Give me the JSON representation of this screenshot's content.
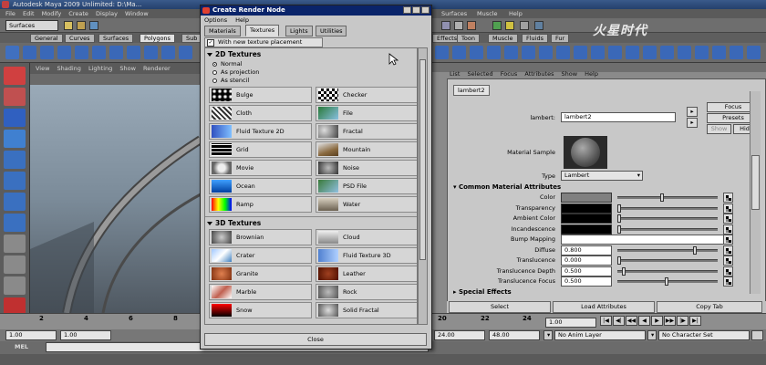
{
  "maya": {
    "title": "Autodesk Maya 2009 Unlimited: D:\\Ma...",
    "menus": [
      "File",
      "Edit",
      "Modify",
      "Create",
      "Display",
      "Window"
    ],
    "menus_right": [
      "Surfaces",
      "Muscle",
      "Help"
    ],
    "mode": "Surfaces",
    "shelf_tabs": [
      "General",
      "Curves",
      "Surfaces",
      "Polygons",
      "Sub"
    ],
    "shelf_tabs_right": [
      "Effects",
      "Toon",
      "Muscle",
      "Fluids",
      "Fur"
    ],
    "viewport_menu": [
      "View",
      "Shading",
      "Lighting",
      "Show",
      "Renderer"
    ],
    "watermark": "火星时代"
  },
  "dialog": {
    "title": "Create Render Node",
    "menus": [
      "Options",
      "Help"
    ],
    "tabs": [
      "Materials",
      "Textures",
      "Lights",
      "Utilities"
    ],
    "active_tab": "Textures",
    "checkbox_label": "With new texture placement",
    "section_2d": "2D Textures",
    "radios": [
      "Normal",
      "As projection",
      "As stencil"
    ],
    "textures_2d": [
      {
        "label": "Bulge",
        "icon": "bulge-icon"
      },
      {
        "label": "Checker",
        "icon": "checker-icon"
      },
      {
        "label": "Cloth",
        "icon": "cloth-icon"
      },
      {
        "label": "File",
        "icon": "file-icon"
      },
      {
        "label": "Fluid Texture 2D",
        "icon": "fluid-texture-2d-icon"
      },
      {
        "label": "Fractal",
        "icon": "fractal-icon"
      },
      {
        "label": "Grid",
        "icon": "grid-icon"
      },
      {
        "label": "Mountain",
        "icon": "mountain-icon"
      },
      {
        "label": "Movie",
        "icon": "movie-icon"
      },
      {
        "label": "Noise",
        "icon": "noise-icon"
      },
      {
        "label": "Ocean",
        "icon": "ocean-icon"
      },
      {
        "label": "PSD File",
        "icon": "psd-file-icon"
      },
      {
        "label": "Ramp",
        "icon": "ramp-icon"
      },
      {
        "label": "Water",
        "icon": "water-icon"
      }
    ],
    "section_3d": "3D Textures",
    "textures_3d": [
      {
        "label": "Brownian",
        "icon": "brownian-icon"
      },
      {
        "label": "Cloud",
        "icon": "cloud-icon"
      },
      {
        "label": "Crater",
        "icon": "crater-icon"
      },
      {
        "label": "Fluid Texture 3D",
        "icon": "fluid-texture-3d-icon"
      },
      {
        "label": "Granite",
        "icon": "granite-icon"
      },
      {
        "label": "Leather",
        "icon": "leather-icon"
      },
      {
        "label": "Marble",
        "icon": "marble-icon"
      },
      {
        "label": "Rock",
        "icon": "rock-icon"
      },
      {
        "label": "Snow",
        "icon": "snow-icon"
      },
      {
        "label": "Solid Fractal",
        "icon": "solid-fractal-icon"
      }
    ],
    "close_label": "Close"
  },
  "attribute_editor": {
    "menus": [
      "List",
      "Selected",
      "Focus",
      "Attributes",
      "Show",
      "Help"
    ],
    "tab": "lambert2",
    "name_label": "lambert:",
    "name_value": "lambert2",
    "buttons": {
      "focus": "Focus",
      "presets": "Presets",
      "show": "Show",
      "hide": "Hide"
    },
    "material_sample_label": "Material Sample",
    "type_label": "Type",
    "type_value": "Lambert",
    "section_common": "Common Material Attributes",
    "attrs": [
      {
        "label": "Color",
        "kind": "swatch",
        "color": "#808080",
        "level": 0.45
      },
      {
        "label": "Transparency",
        "kind": "swatch",
        "color": "#000000",
        "level": 0.0
      },
      {
        "label": "Ambient Color",
        "kind": "swatch",
        "color": "#000000",
        "level": 0.0
      },
      {
        "label": "Incandescence",
        "kind": "swatch",
        "color": "#000000",
        "level": 0.0
      },
      {
        "label": "Bump Mapping",
        "kind": "field",
        "value": ""
      },
      {
        "label": "Diffuse",
        "kind": "number",
        "value": "0.800",
        "level": 0.8
      },
      {
        "label": "Translucence",
        "kind": "number",
        "value": "0.000",
        "level": 0.0
      },
      {
        "label": "Translucence Depth",
        "kind": "number",
        "value": "0.500",
        "level": 0.05
      },
      {
        "label": "Translucence Focus",
        "kind": "number",
        "value": "0.500",
        "level": 0.5
      }
    ],
    "section_special": "Special Effects",
    "bottom_buttons": [
      "Select",
      "Load Attributes",
      "Copy Tab"
    ]
  },
  "timeline": {
    "ticks": [
      "2",
      "4",
      "6",
      "8",
      "20",
      "22",
      "24"
    ],
    "current_frame": "1.00",
    "range": {
      "start": "1.00",
      "inner_start": "1.00",
      "inner_end": "24.00",
      "end": "48.00"
    },
    "anim_layer": "No Anim Layer",
    "character_set": "No Character Set",
    "current_time": "1.00"
  },
  "command_line": {
    "label": "MEL"
  },
  "colors": {
    "title_blue": "#0a246a",
    "panel_grey": "#c8c8c8"
  }
}
